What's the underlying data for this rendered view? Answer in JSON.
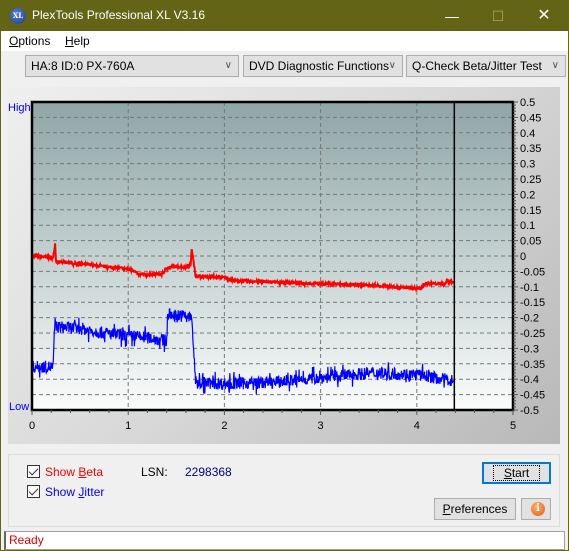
{
  "window": {
    "title": "PlexTools Professional XL V3.16",
    "app_icon_text": "XL",
    "minimize": "—",
    "maximize": "☐",
    "close": "✕"
  },
  "menu": {
    "items": [
      {
        "label": "Options",
        "accel": "O",
        "rest": "ptions"
      },
      {
        "label": "Help",
        "accel": "H",
        "rest": "elp"
      }
    ]
  },
  "toolbar": {
    "drive_select": "HA:8 ID:0  PX-760A",
    "function_select": "DVD Diagnostic Functions",
    "test_select": "Q-Check Beta/Jitter Test",
    "arrow": "∨"
  },
  "chart_data": {
    "type": "line",
    "title": "",
    "xlabel": "",
    "ylabel_left_top": "High",
    "ylabel_left_bottom": "Low",
    "xlim": [
      0,
      5
    ],
    "ylim": [
      -0.5,
      0.5
    ],
    "x_ticks": [
      0,
      1,
      2,
      3,
      4,
      5
    ],
    "y_ticks": [
      0.5,
      0.45,
      0.4,
      0.35,
      0.3,
      0.25,
      0.2,
      0.15,
      0.1,
      0.05,
      0,
      -0.05,
      -0.1,
      -0.15,
      -0.2,
      -0.25,
      -0.3,
      -0.35,
      -0.4,
      -0.45,
      -0.5
    ],
    "y_tick_labels": [
      "0.5",
      "0.45",
      "0.4",
      "0.35",
      "0.3",
      "0.25",
      "0.2",
      "0.15",
      "0.1",
      "0.05",
      "0",
      "-0.05",
      "-0.1",
      "-0.15",
      "-0.2",
      "-0.25",
      "-0.3",
      "-0.35",
      "-0.4",
      "-0.45",
      "-0.5"
    ],
    "grid": true,
    "cursor_x": 4.39,
    "series": [
      {
        "name": "Beta",
        "color": "#ff0000",
        "x": [
          0,
          0.22,
          0.24,
          0.25,
          0.5,
          0.75,
          0.95,
          1.05,
          1.1,
          1.35,
          1.4,
          1.45,
          1.6,
          1.65,
          1.66,
          1.7,
          2.0,
          2.1,
          2.5,
          3.0,
          3.5,
          4.0,
          4.06,
          4.07,
          4.3,
          4.31,
          4.38
        ],
        "y": [
          0.0,
          -0.005,
          0.04,
          -0.02,
          -0.025,
          -0.035,
          -0.04,
          -0.045,
          -0.06,
          -0.06,
          -0.04,
          -0.035,
          -0.035,
          -0.03,
          0.025,
          -0.065,
          -0.07,
          -0.08,
          -0.085,
          -0.09,
          -0.095,
          -0.105,
          -0.105,
          -0.09,
          -0.09,
          -0.08,
          -0.085
        ],
        "noise": 0.004
      },
      {
        "name": "Jitter",
        "color": "#0000ff",
        "x": [
          0,
          0.22,
          0.24,
          0.25,
          0.5,
          0.75,
          1.0,
          1.2,
          1.4,
          1.41,
          1.6,
          1.66,
          1.68,
          1.7,
          2.0,
          2.5,
          3.0,
          3.5,
          4.0,
          4.38
        ],
        "y": [
          -0.36,
          -0.36,
          -0.2,
          -0.23,
          -0.235,
          -0.25,
          -0.26,
          -0.265,
          -0.275,
          -0.19,
          -0.195,
          -0.2,
          -0.3,
          -0.41,
          -0.415,
          -0.41,
          -0.395,
          -0.38,
          -0.385,
          -0.405
        ],
        "noise": 0.02
      }
    ]
  },
  "bottom": {
    "show_beta": {
      "label": "Show Beta",
      "prefix": "Show ",
      "accel": "B",
      "rest": "eta",
      "checked": true,
      "color": "#ff0000"
    },
    "show_jitter": {
      "label": "Show Jitter",
      "prefix": "Show ",
      "accel": "J",
      "rest": "itter",
      "checked": true,
      "color": "#0000ff"
    },
    "lsn_label": "LSN:",
    "lsn_value": "2298368",
    "start_button": {
      "accel": "S",
      "rest": "tart"
    },
    "preferences_button": {
      "accel": "P",
      "rest": "references"
    },
    "info_icon": "i"
  },
  "status": {
    "text": "Ready"
  }
}
